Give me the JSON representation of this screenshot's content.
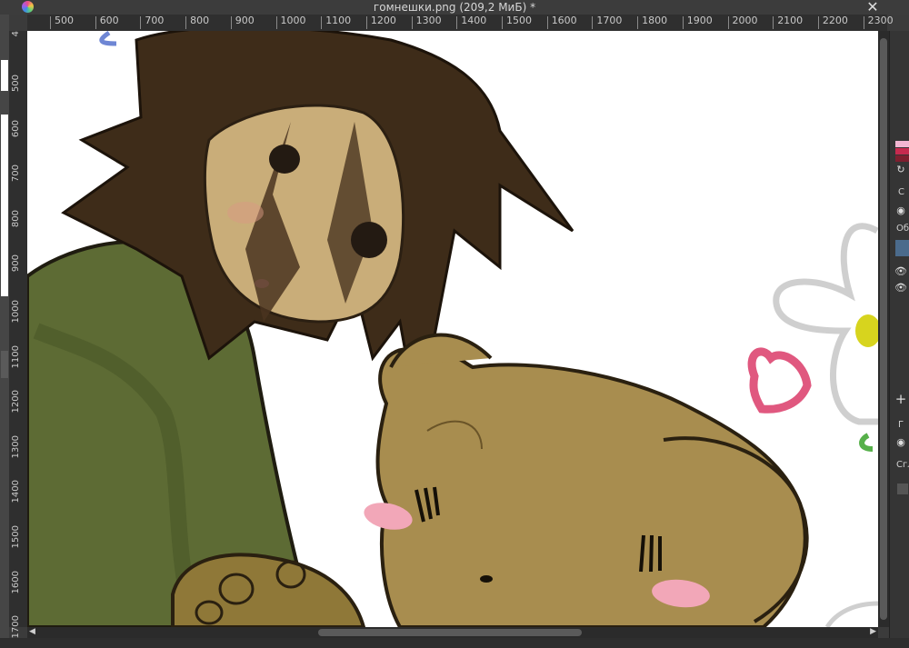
{
  "window": {
    "title": "гомнешки.png (209,2 МиБ) *",
    "close_glyph": "✕",
    "app_icon": "krita-logo-icon"
  },
  "ruler": {
    "horizontal": [
      "500",
      "600",
      "700",
      "800",
      "900",
      "1000",
      "1100",
      "1200",
      "1300",
      "1400",
      "1500",
      "1600",
      "1700",
      "1800",
      "1900",
      "2000",
      "2100",
      "2200",
      "2300"
    ],
    "vertical": [
      "4",
      "500",
      "600",
      "700",
      "800",
      "900",
      "1000",
      "1100",
      "1200",
      "1300",
      "1400",
      "1500",
      "1600",
      "1700"
    ]
  },
  "dock": {
    "colors": [
      "#f2b6d2",
      "#c62a4f",
      "#7e1f2f"
    ],
    "labels": [
      "С",
      "Об",
      "Г",
      "Сгл"
    ],
    "plus_glyph": "+",
    "refresh_glyph": "↻"
  },
  "scroll": {
    "left_arrow": "◀",
    "right_arrow": "▶",
    "up_arrow": "▲",
    "down_arrow": "▼"
  }
}
